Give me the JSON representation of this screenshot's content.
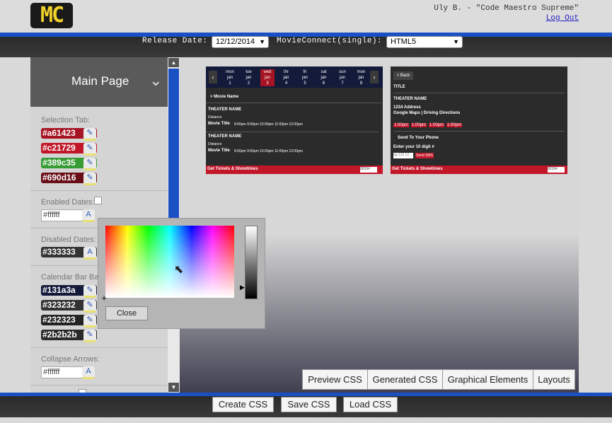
{
  "header": {
    "logo_text": "MC",
    "user_label": "Uly B. - \"Code Maestro Supreme\"",
    "logout_label": "Log Out"
  },
  "toolbar": {
    "release_label": "Release Date:",
    "release_value": "12/12/2014",
    "movieconnect_label": "MovieConnect(single):",
    "movieconnect_value": "HTML5"
  },
  "sidebar": {
    "title": "Main Page",
    "selection_tab_label": "Selection Tab:",
    "selection_colors": [
      "#a61423",
      "#c21729",
      "#389c35",
      "#690d16"
    ],
    "enabled_dates_label": "Enabled Dates:",
    "enabled_value": "#ffffff",
    "disabled_dates_label": "Disabled Dates:",
    "disabled_value": "#333333",
    "calendar_bar_label": "Calendar Bar Ba",
    "calendar_colors": [
      "#131a3a",
      "#323232",
      "#232323",
      "#2b2b2b"
    ],
    "collapse_arrows_label": "Collapse Arrows:",
    "collapse_value": "#ffffff"
  },
  "phone1": {
    "days": [
      {
        "d": "mon",
        "m": "jan",
        "n": "1"
      },
      {
        "d": "tue",
        "m": "jan",
        "n": "2"
      },
      {
        "d": "wed",
        "m": "jan",
        "n": "3"
      },
      {
        "d": "thr",
        "m": "jan",
        "n": "4"
      },
      {
        "d": "fri",
        "m": "jan",
        "n": "5"
      },
      {
        "d": "sat",
        "m": "jan",
        "n": "6"
      },
      {
        "d": "sun",
        "m": "jan",
        "n": "7"
      },
      {
        "d": "mon",
        "m": "jan",
        "n": "8"
      }
    ],
    "movie_name": "> Movie Name",
    "theater_name": "THEATER NAME",
    "distance": "Distance",
    "movie_title": "Movie Title",
    "times": "8:00pm 9:00pm 10:00pm 11:00pm 12:00pm",
    "footer": "Get Tickets & Showtimes",
    "zip": "90394"
  },
  "phone2": {
    "back": "< Back",
    "title": "TITLE",
    "theater_name": "THEATER NAME",
    "address": "1234 Address",
    "maps": "Google Maps | Driving Directions",
    "times": [
      "1:00pm",
      "1:00pm",
      "1:00pm",
      "1:00pm"
    ],
    "send_label": "Send To Your Phone",
    "enter_label": "Enter your 10 digit #",
    "phone_placeholder": "eg 123 12",
    "send_sms": "Send SMS",
    "footer": "Get Tickets & Showtimes",
    "zip": "90394"
  },
  "tabs": [
    "Preview CSS",
    "Generated CSS",
    "Graphical Elements",
    "Layouts"
  ],
  "bottom_buttons": [
    "Create CSS",
    "Save CSS",
    "Load CSS"
  ],
  "colorpicker": {
    "close_label": "Close"
  },
  "colors": {
    "accent_blue": "#1b50c4",
    "brand_red": "#c21729"
  }
}
